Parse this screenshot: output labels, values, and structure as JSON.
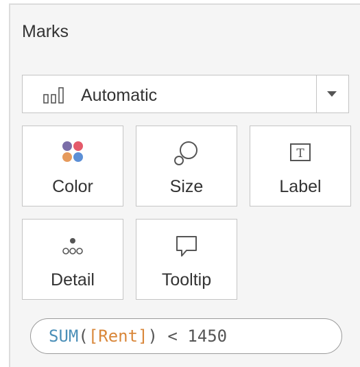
{
  "marks": {
    "title": "Marks",
    "mark_type": {
      "selected": "Automatic",
      "icon": "bar-chart-icon"
    },
    "cards": [
      {
        "label": "Color",
        "icon": "color-dots-icon",
        "colors": [
          "#7b6ea8",
          "#e45a6a",
          "#e69a5c",
          "#5c8fd6"
        ]
      },
      {
        "label": "Size",
        "icon": "size-icon"
      },
      {
        "label": "Label",
        "icon": "label-icon",
        "icon_text": "T"
      },
      {
        "label": "Detail",
        "icon": "detail-dots-icon"
      },
      {
        "label": "Tooltip",
        "icon": "tooltip-icon"
      }
    ],
    "filter_pill": {
      "function": "SUM",
      "open_paren": "(",
      "field": "[Rent]",
      "close_paren": ")",
      "operator": " < ",
      "value": "1450",
      "colors": {
        "function": "#4b8fb8",
        "field": "#d9873a"
      }
    }
  }
}
